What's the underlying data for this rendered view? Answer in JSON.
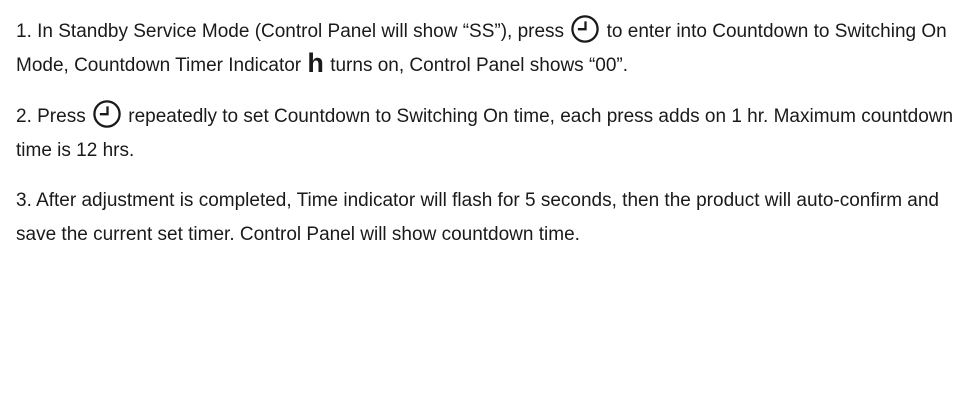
{
  "steps": [
    {
      "part1": "1. In Standby Service Mode (Control Panel will show “SS”), press ",
      "part2": " to enter into Countdown to Switching On Mode, Countdown Timer Indicator ",
      "indicator_glyph": "h",
      "part3": " turns on, Control Panel shows “00”."
    },
    {
      "part1": "2. Press ",
      "part2": " repeatedly to set Countdown to Switching On time, each press adds on 1 hr. Maximum countdown time is 12 hrs."
    },
    {
      "text": "3. After adjustment is completed, Time indicator will flash for 5 seconds, then the product will auto-confirm and save the current set timer. Control Panel will show countdown time."
    }
  ],
  "icons": {
    "timer_button": "timer-button-icon"
  }
}
